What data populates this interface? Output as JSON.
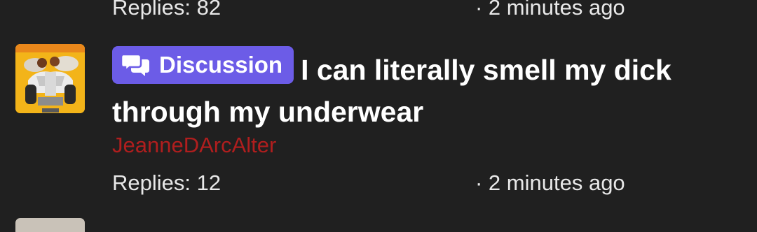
{
  "previous_thread": {
    "replies": "Replies: 82",
    "time": "· 2 minutes ago"
  },
  "thread": {
    "badge": {
      "icon": "chat-bubbles-icon",
      "label": "Discussion",
      "color": "#6c5ce7"
    },
    "title": "I can literally smell my dick through my underwear",
    "author": "JeanneDArcAlter",
    "author_color": "#b01e1e",
    "replies": "Replies: 12",
    "time": "· 2 minutes ago"
  },
  "theme": {
    "background": "#202020",
    "text": "#ffffff"
  }
}
